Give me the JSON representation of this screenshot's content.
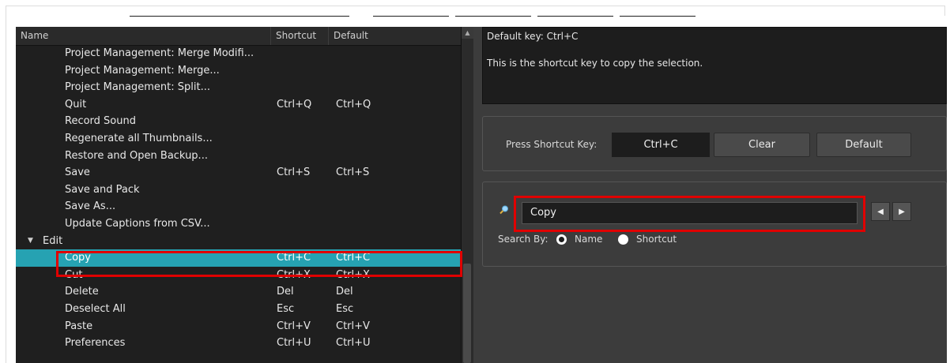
{
  "list": {
    "columns": {
      "name": "Name",
      "shortcut": "Shortcut",
      "default": "Default"
    },
    "rows": [
      {
        "name": "Project Management: Merge Modifi...",
        "shortcut": "",
        "default": ""
      },
      {
        "name": "Project Management: Merge...",
        "shortcut": "",
        "default": ""
      },
      {
        "name": "Project Management: Split...",
        "shortcut": "",
        "default": ""
      },
      {
        "name": "Quit",
        "shortcut": "Ctrl+Q",
        "default": "Ctrl+Q"
      },
      {
        "name": "Record Sound",
        "shortcut": "",
        "default": ""
      },
      {
        "name": "Regenerate all Thumbnails...",
        "shortcut": "",
        "default": ""
      },
      {
        "name": "Restore and Open Backup...",
        "shortcut": "",
        "default": ""
      },
      {
        "name": "Save",
        "shortcut": "Ctrl+S",
        "default": "Ctrl+S"
      },
      {
        "name": "Save and Pack",
        "shortcut": "",
        "default": ""
      },
      {
        "name": "Save As...",
        "shortcut": "",
        "default": ""
      },
      {
        "name": "Update Captions from CSV...",
        "shortcut": "",
        "default": ""
      },
      {
        "name": "Edit",
        "shortcut": "",
        "default": "",
        "group": true
      },
      {
        "name": "Copy",
        "shortcut": "Ctrl+C",
        "default": "Ctrl+C",
        "selected": true
      },
      {
        "name": "Cut",
        "shortcut": "Ctrl+X",
        "default": "Ctrl+X"
      },
      {
        "name": "Delete",
        "shortcut": "Del",
        "default": "Del"
      },
      {
        "name": "Deselect All",
        "shortcut": "Esc",
        "default": "Esc"
      },
      {
        "name": "Paste",
        "shortcut": "Ctrl+V",
        "default": "Ctrl+V"
      },
      {
        "name": "Preferences",
        "shortcut": "Ctrl+U",
        "default": "Ctrl+U"
      }
    ]
  },
  "description": {
    "default_key": "Default key: Ctrl+C",
    "text": "This is the shortcut key to copy the selection."
  },
  "shortcut": {
    "label": "Press Shortcut Key:",
    "value": "Ctrl+C",
    "clear_label": "Clear",
    "default_label": "Default"
  },
  "search": {
    "value": "Copy",
    "search_by_label": "Search By:",
    "option_name": "Name",
    "option_shortcut": "Shortcut",
    "selected_option": "Name"
  },
  "colors": {
    "selection": "#26a2b2",
    "highlight": "#e00000",
    "background": "#3c3c3c"
  }
}
